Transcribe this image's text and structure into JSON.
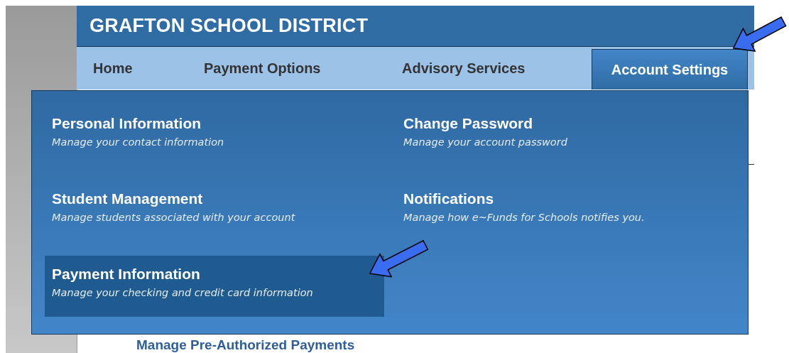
{
  "header": {
    "title": "GRAFTON SCHOOL DISTRICT"
  },
  "nav": {
    "tabs": [
      {
        "label": "Home",
        "selected": false
      },
      {
        "label": "Payment Options",
        "selected": false
      },
      {
        "label": "Advisory Services",
        "selected": false
      },
      {
        "label": "Account Settings",
        "selected": true
      }
    ]
  },
  "menu": {
    "items": [
      {
        "title": "Personal Information",
        "description": "Manage your contact information",
        "selected": false
      },
      {
        "title": "Change Password",
        "description": "Manage your account password",
        "selected": false
      },
      {
        "title": "Student Management",
        "description": "Manage students associated with your account",
        "selected": false
      },
      {
        "title": "Notifications",
        "description": "Manage how e~Funds for Schools notifies you.",
        "selected": false
      },
      {
        "title": "Payment Information",
        "description": "Manage your checking and credit card information",
        "selected": true
      }
    ]
  },
  "content": {
    "link": "Manage Pre-Authorized Payments"
  }
}
